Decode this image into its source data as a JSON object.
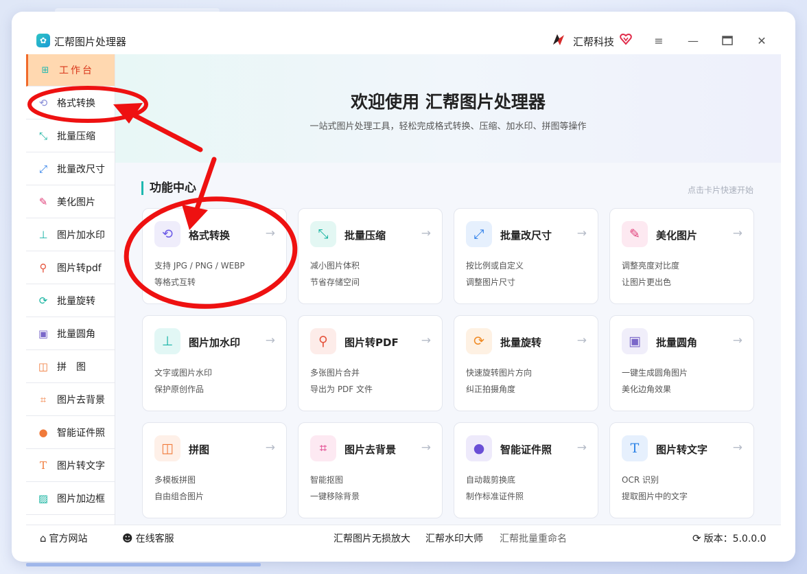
{
  "app": {
    "title": "汇帮图片处理器",
    "brand": "汇帮科技"
  },
  "window_controls": [
    "menu-icon",
    "minimize-icon",
    "maximize-icon",
    "close-icon"
  ],
  "sidebar": {
    "items": [
      {
        "label": "工作台",
        "icon": "grid-icon",
        "active": true
      },
      {
        "label": "格式转换",
        "icon": "convert-icon"
      },
      {
        "label": "批量压缩",
        "icon": "compress-icon"
      },
      {
        "label": "批量改尺寸",
        "icon": "resize-icon"
      },
      {
        "label": "美化图片",
        "icon": "beautify-icon"
      },
      {
        "label": "图片加水印",
        "icon": "watermark-icon"
      },
      {
        "label": "图片转pdf",
        "icon": "pdf-icon"
      },
      {
        "label": "批量旋转",
        "icon": "rotate-icon"
      },
      {
        "label": "批量圆角",
        "icon": "round-corner-icon"
      },
      {
        "label": "拼　图",
        "icon": "collage-icon"
      },
      {
        "label": "图片去背景",
        "icon": "crop-icon"
      },
      {
        "label": "智能证件照",
        "icon": "person-icon"
      },
      {
        "label": "图片转文字",
        "icon": "text-icon"
      },
      {
        "label": "图片加边框",
        "icon": "frame-icon"
      }
    ]
  },
  "banner": {
    "title": "欢迎使用 汇帮图片处理器",
    "subtitle": "一站式图片处理工具，轻松完成格式转换、压缩、加水印、拼图等操作"
  },
  "section": {
    "title": "功能中心",
    "hint": "点击卡片快速开始"
  },
  "cards": [
    {
      "title": "格式转换",
      "desc1": "支持 JPG / PNG / WEBP",
      "desc2": "等格式互转",
      "icon": "convert-icon",
      "color": "#6c5ce7",
      "bg": "#efedfb"
    },
    {
      "title": "批量压缩",
      "desc1": "减小图片体积",
      "desc2": "节省存储空间",
      "icon": "compress-icon",
      "color": "#16b3a0",
      "bg": "#e3f7f3"
    },
    {
      "title": "批量改尺寸",
      "desc1": "按比例或自定义",
      "desc2": "调整图片尺寸",
      "icon": "resize-icon",
      "color": "#2b7de9",
      "bg": "#e6f0fd"
    },
    {
      "title": "美化图片",
      "desc1": "调整亮度对比度",
      "desc2": "让图片更出色",
      "icon": "beautify-icon",
      "color": "#e0407a",
      "bg": "#fde9f1"
    },
    {
      "title": "图片加水印",
      "desc1": "文字或图片水印",
      "desc2": "保护原创作品",
      "icon": "watermark-icon",
      "color": "#17b3a6",
      "bg": "#e2f7f5"
    },
    {
      "title": "图片转PDF",
      "desc1": "多张图片合并",
      "desc2": "导出为 PDF 文件",
      "icon": "pdf-icon",
      "color": "#e5533c",
      "bg": "#fdece9"
    },
    {
      "title": "批量旋转",
      "desc1": "快速旋转图片方向",
      "desc2": "纠正拍摄角度",
      "icon": "rotate-icon",
      "color": "#f08a24",
      "bg": "#fef1e3"
    },
    {
      "title": "批量圆角",
      "desc1": "一键生成圆角图片",
      "desc2": "美化边角效果",
      "icon": "round-corner-icon",
      "color": "#7b68c9",
      "bg": "#f0eefa"
    },
    {
      "title": "拼图",
      "desc1": "多模板拼图",
      "desc2": "自由组合图片",
      "icon": "collage-icon",
      "color": "#f07a3a",
      "bg": "#fef0e8"
    },
    {
      "title": "图片去背景",
      "desc1": "智能抠图",
      "desc2": "一键移除背景",
      "icon": "crop-icon",
      "color": "#e0408a",
      "bg": "#fde9f2"
    },
    {
      "title": "智能证件照",
      "desc1": "自动裁剪换底",
      "desc2": "制作标准证件照",
      "icon": "person-icon",
      "color": "#6a4fd6",
      "bg": "#eeeafb"
    },
    {
      "title": "图片转文字",
      "desc1": "OCR 识别",
      "desc2": "提取图片中的文字",
      "icon": "text-icon",
      "color": "#2b82e6",
      "bg": "#e6f0fd"
    }
  ],
  "footer": {
    "website": "官方网站",
    "support": "在线客服",
    "link1": "汇帮图片无损放大",
    "link2": "汇帮水印大师",
    "link3": "汇帮批量重命名",
    "version": "版本：5.0.0.0"
  },
  "colors": {
    "accent": "#1fb8b0",
    "active_bg": "#ffd8b0",
    "active_text": "#d9361a",
    "annotation": "#ee1111"
  }
}
